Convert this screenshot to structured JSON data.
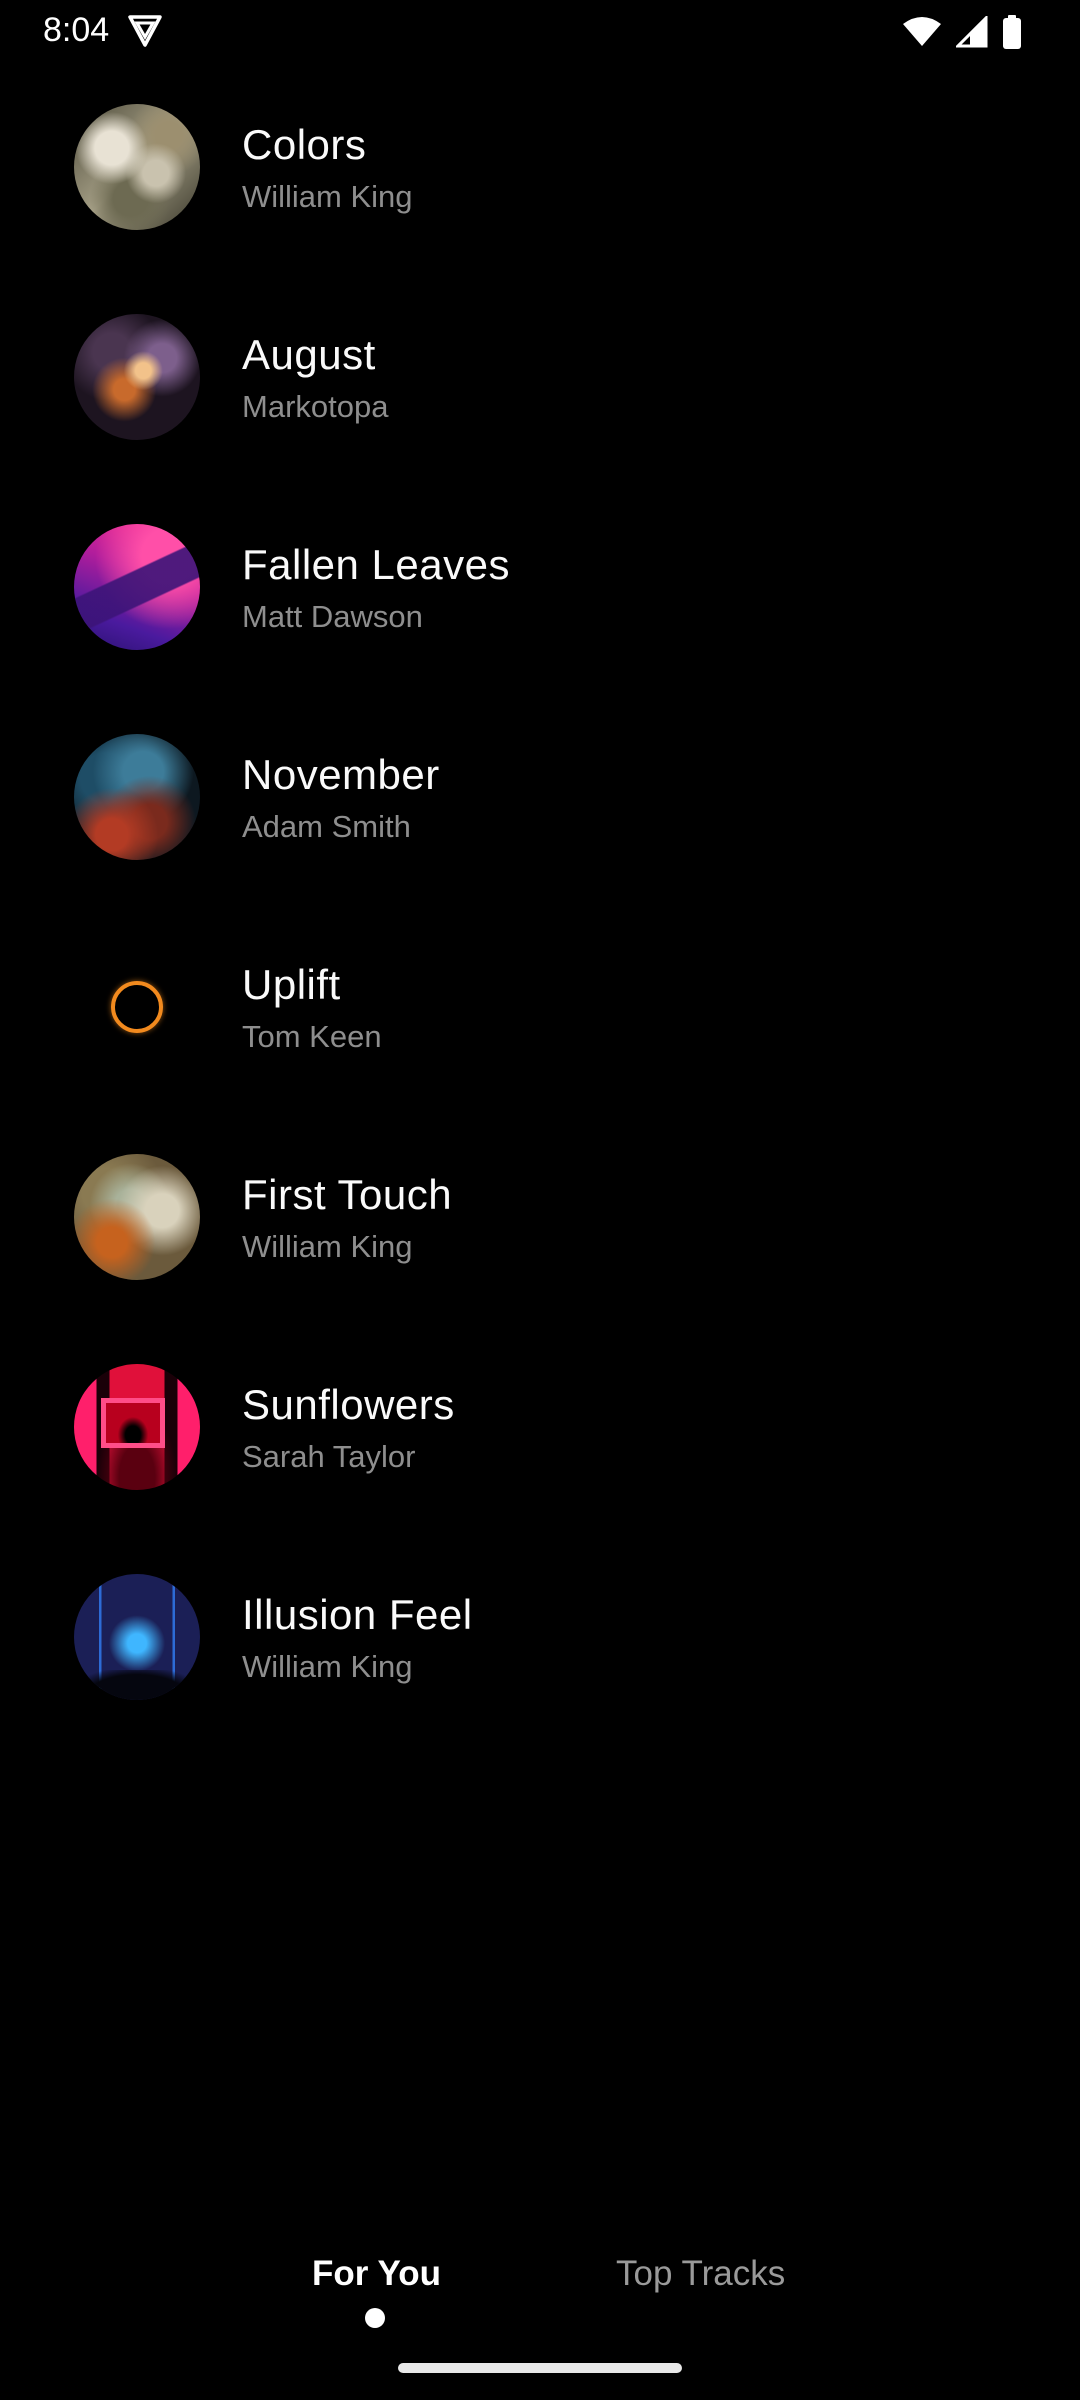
{
  "status_bar": {
    "time": "8:04"
  },
  "tracks": [
    {
      "title": "Colors",
      "artist": "William King"
    },
    {
      "title": "August",
      "artist": "Markotopa"
    },
    {
      "title": "Fallen Leaves",
      "artist": "Matt Dawson"
    },
    {
      "title": "November",
      "artist": "Adam Smith"
    },
    {
      "title": "Uplift",
      "artist": "Tom Keen"
    },
    {
      "title": "First Touch",
      "artist": "William King"
    },
    {
      "title": "Sunflowers",
      "artist": "Sarah Taylor"
    },
    {
      "title": "Illusion Feel",
      "artist": "William King"
    }
  ],
  "tabs": [
    {
      "label": "For You",
      "selected": true
    },
    {
      "label": "Top Tracks",
      "selected": false
    }
  ],
  "colors": {
    "background": "#000000",
    "title_text": "#fafafa",
    "artist_text": "#8e8e8e",
    "tab_selected": "#ffffff",
    "tab_unselected": "#9a9a9a"
  }
}
